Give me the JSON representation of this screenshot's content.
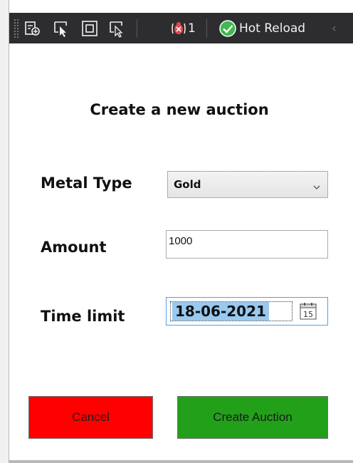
{
  "toolbar": {
    "icons": [
      "go-to-live-visual-tree-icon",
      "select-element-icon",
      "display-layout-adorners-icon",
      "track-focused-element-icon"
    ],
    "binding_failures_count": "1",
    "hot_reload_label": "Hot Reload",
    "hot_reload_status_color": "#3fb950",
    "bug_color": "#e5484d"
  },
  "form": {
    "title": "Create a new auction",
    "metal_type_label": "Metal Type",
    "metal_type_value": "Gold",
    "amount_label": "Amount",
    "amount_value": "1000",
    "time_limit_label": "Time limit",
    "time_limit_value": "18-06-2021",
    "calendar_day": "15"
  },
  "buttons": {
    "cancel_label": "Cancel",
    "cancel_color": "#ff0000",
    "create_label": "Create Auction",
    "create_color": "#22a01a"
  }
}
